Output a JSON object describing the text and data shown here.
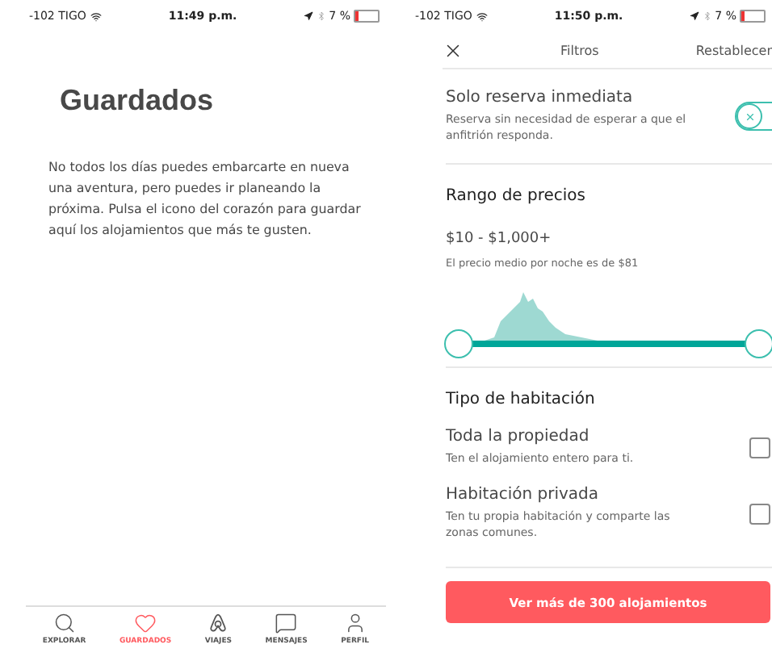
{
  "saved_screen": {
    "status_bar": {
      "carrier": "-102 TIGO",
      "time": "11:49 p.m.",
      "battery": "7 %"
    },
    "title": "Guardados",
    "body": "No todos los días puedes embarcarte en nueva una aventura, pero puedes ir planeando la próxima. Pulsa el icono del corazón para guardar aquí los alojamientos que más te gusten.",
    "tab_bar": [
      {
        "label": "EXPLORAR",
        "selected": false
      },
      {
        "label": "GUARDADOS",
        "selected": true
      },
      {
        "label": "VIAJES",
        "selected": false
      },
      {
        "label": "MENSAJES",
        "selected": false
      },
      {
        "label": "PERFIL",
        "selected": false
      }
    ]
  },
  "filters_screen": {
    "status_bar": {
      "carrier": "-102 TIGO",
      "time": "11:50 p.m.",
      "battery": "7 %"
    },
    "nav": {
      "title": "Filtros",
      "action": "Restablecer"
    },
    "instant_book": {
      "label": "Solo reserva inmediata",
      "description": "Reserva sin necesidad de esperar a que el anfitrión responda.",
      "on": false
    },
    "price_range": {
      "heading": "Rango de precios",
      "range": "$10 - $1,000+",
      "average": "El precio medio por noche es de $81",
      "low_thumb": {
        "level": 0
      },
      "high_thumb": {
        "level": 1
      }
    },
    "room_type": {
      "heading": "Tipo de habitación",
      "options": [
        {
          "label": "Toda la propiedad",
          "description": "Ten el alojamiento entero para ti.",
          "checked": false
        },
        {
          "label": "Habitación privada",
          "description": "Ten tu propia habitación y comparte las zonas comunes.",
          "checked": false
        }
      ]
    },
    "submit": "Ver más de 300 alojamientos"
  }
}
